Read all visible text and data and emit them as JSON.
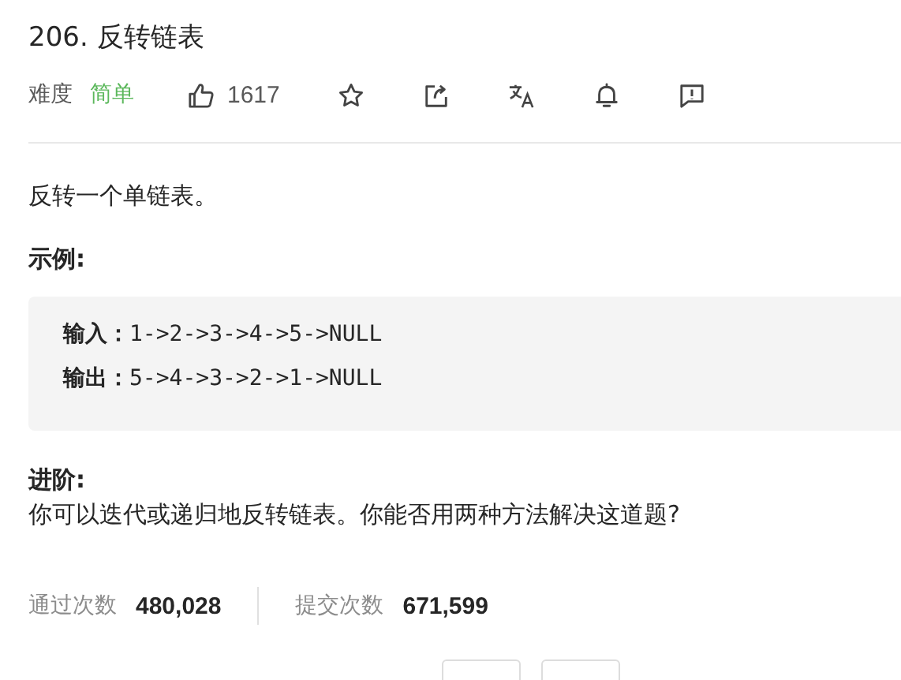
{
  "problem": {
    "number": "206.",
    "title": "反转链表"
  },
  "meta": {
    "difficulty_label": "难度",
    "difficulty": "简单",
    "likes": "1617"
  },
  "description": "反转一个单链表。",
  "example": {
    "heading": "示例:",
    "lines": [
      {
        "label": "输入：",
        "value": "1->2->3->4->5->NULL"
      },
      {
        "label": "输出：",
        "value": "5->4->3->2->1->NULL"
      }
    ]
  },
  "advanced": {
    "heading": "进阶:",
    "text": "你可以迭代或递归地反转链表。你能否用两种方法解决这道题?"
  },
  "stats": [
    {
      "label": "通过次数",
      "value": "480,028"
    },
    {
      "label": "提交次数",
      "value": "671,599"
    }
  ]
}
